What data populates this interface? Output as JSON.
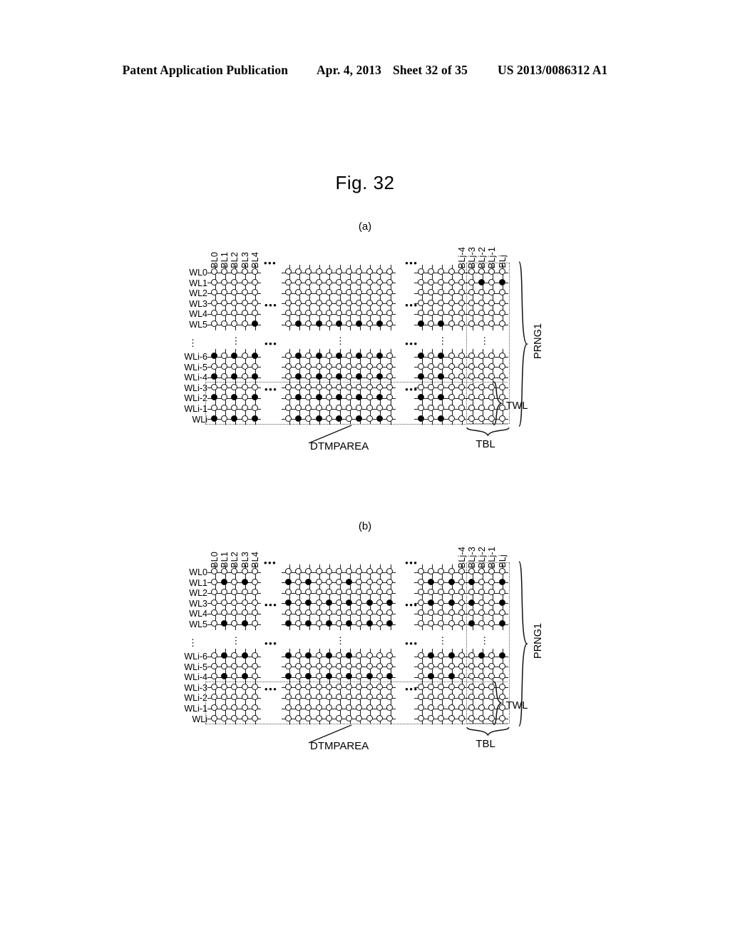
{
  "header": {
    "publication": "Patent Application Publication",
    "date": "Apr. 4, 2013",
    "sheet": "Sheet 32 of 35",
    "number": "US 2013/0086312 A1"
  },
  "figure": {
    "title": "Fig. 32",
    "subfigures": [
      {
        "id": "a",
        "label": "(a)"
      },
      {
        "id": "b",
        "label": "(b)"
      }
    ]
  },
  "axes": {
    "bitline_labels_left": [
      "BL0",
      "BL1",
      "BL2",
      "BL3",
      "BL4"
    ],
    "bitline_labels_right": [
      "BLj-4",
      "BLj-3",
      "BLj-2",
      "BLj-1",
      "BLj"
    ],
    "bitline_ellipsis": "•••",
    "wordline_labels_top": [
      "WL0",
      "WL1",
      "WL2",
      "WL3",
      "WL4",
      "WL5"
    ],
    "wordline_labels_bottom": [
      "WLi-6",
      "WLi-5",
      "WLi-4",
      "WLi-3",
      "WLi-2",
      "WLi-1",
      "WLi"
    ],
    "wordline_ellipsis": "⋮"
  },
  "annotations": {
    "prng1": "PRNG1",
    "twl": "TWL",
    "dtmparea": "DTMPAREA",
    "tbl": "TBL"
  },
  "chart_data": {
    "type": "diagram",
    "description": "Memory cell array maps showing programmed (filled) and erased (open) memory cells across word lines and bit lines",
    "legend": {
      "filled": "programmed cell (solid circle)",
      "open": "erased cell (open circle)"
    },
    "panels": [
      {
        "id": "a",
        "label": "(a)",
        "row_groups": [
          {
            "rows": [
              "WL0",
              "WL1",
              "WL2",
              "WL3",
              "WL4",
              "WL5"
            ]
          },
          {
            "rows": [
              "WLi-6",
              "WLi-5",
              "WLi-4",
              "WLi-3",
              "WLi-2",
              "WLi-1",
              "WLi"
            ]
          }
        ],
        "col_groups": [
          {
            "cols": [
              "BL0",
              "BL1",
              "BL2",
              "BL3",
              "BL4"
            ],
            "count": 5
          },
          {
            "cols": [],
            "count": 11
          },
          {
            "cols": [
              "BLj-4",
              "BLj-3",
              "BLj-2",
              "BLj-1",
              "BLj"
            ],
            "count": 9
          }
        ],
        "blocks": [
          {
            "name": "top-left",
            "cols": 5,
            "rows": 6,
            "filled": [
              [
                5,
                4
              ]
            ]
          },
          {
            "name": "top-mid",
            "cols": 11,
            "rows": 6,
            "filled": [
              [
                5,
                1
              ],
              [
                5,
                3
              ],
              [
                5,
                5
              ],
              [
                5,
                7
              ],
              [
                5,
                9
              ]
            ]
          },
          {
            "name": "top-right",
            "cols": 9,
            "rows": 6,
            "filled": [
              [
                1,
                6
              ],
              [
                1,
                8
              ],
              [
                5,
                0
              ],
              [
                5,
                2
              ]
            ]
          },
          {
            "name": "bottom-left",
            "cols": 5,
            "rows": 7,
            "filled": [
              [
                0,
                0
              ],
              [
                0,
                2
              ],
              [
                0,
                4
              ],
              [
                2,
                0
              ],
              [
                2,
                2
              ],
              [
                2,
                4
              ],
              [
                4,
                0
              ],
              [
                4,
                2
              ],
              [
                4,
                4
              ],
              [
                6,
                0
              ],
              [
                6,
                2
              ],
              [
                6,
                4
              ]
            ]
          },
          {
            "name": "bottom-mid",
            "cols": 11,
            "rows": 7,
            "filled": [
              [
                0,
                1
              ],
              [
                0,
                3
              ],
              [
                0,
                5
              ],
              [
                0,
                7
              ],
              [
                0,
                9
              ],
              [
                2,
                1
              ],
              [
                2,
                3
              ],
              [
                2,
                5
              ],
              [
                2,
                7
              ],
              [
                2,
                9
              ],
              [
                4,
                1
              ],
              [
                4,
                3
              ],
              [
                4,
                5
              ],
              [
                4,
                7
              ],
              [
                4,
                9
              ],
              [
                6,
                1
              ],
              [
                6,
                3
              ],
              [
                6,
                5
              ],
              [
                6,
                7
              ],
              [
                6,
                9
              ]
            ]
          },
          {
            "name": "bottom-right",
            "cols": 9,
            "rows": 7,
            "filled": [
              [
                0,
                0
              ],
              [
                0,
                2
              ],
              [
                2,
                0
              ],
              [
                2,
                2
              ],
              [
                4,
                0
              ],
              [
                4,
                2
              ],
              [
                6,
                0
              ],
              [
                6,
                2
              ]
            ]
          }
        ]
      },
      {
        "id": "b",
        "label": "(b)",
        "row_groups": [
          {
            "rows": [
              "WL0",
              "WL1",
              "WL2",
              "WL3",
              "WL4",
              "WL5"
            ]
          },
          {
            "rows": [
              "WLi-6",
              "WLi-5",
              "WLi-4",
              "WLi-3",
              "WLi-2",
              "WLi-1",
              "WLi"
            ]
          }
        ],
        "col_groups": [
          {
            "cols": [
              "BL0",
              "BL1",
              "BL2",
              "BL3",
              "BL4"
            ],
            "count": 5
          },
          {
            "cols": [],
            "count": 11
          },
          {
            "cols": [
              "BLj-4",
              "BLj-3",
              "BLj-2",
              "BLj-1",
              "BLj"
            ],
            "count": 9
          }
        ],
        "blocks": [
          {
            "name": "top-left",
            "cols": 5,
            "rows": 6,
            "filled": [
              [
                1,
                1
              ],
              [
                1,
                3
              ],
              [
                5,
                1
              ],
              [
                5,
                3
              ]
            ]
          },
          {
            "name": "top-mid",
            "cols": 11,
            "rows": 6,
            "filled": [
              [
                1,
                0
              ],
              [
                1,
                2
              ],
              [
                1,
                6
              ],
              [
                3,
                0
              ],
              [
                3,
                2
              ],
              [
                3,
                4
              ],
              [
                3,
                6
              ],
              [
                3,
                8
              ],
              [
                3,
                10
              ],
              [
                5,
                0
              ],
              [
                5,
                2
              ],
              [
                5,
                4
              ],
              [
                5,
                6
              ],
              [
                5,
                8
              ],
              [
                5,
                10
              ]
            ]
          },
          {
            "name": "top-right",
            "cols": 9,
            "rows": 6,
            "filled": [
              [
                1,
                1
              ],
              [
                1,
                3
              ],
              [
                1,
                5
              ],
              [
                1,
                8
              ],
              [
                3,
                1
              ],
              [
                3,
                3
              ],
              [
                3,
                5
              ],
              [
                3,
                8
              ],
              [
                5,
                5
              ],
              [
                5,
                8
              ]
            ]
          },
          {
            "name": "bottom-left",
            "cols": 5,
            "rows": 7,
            "filled": [
              [
                0,
                1
              ],
              [
                0,
                3
              ],
              [
                2,
                1
              ],
              [
                2,
                3
              ]
            ]
          },
          {
            "name": "bottom-mid",
            "cols": 11,
            "rows": 7,
            "filled": [
              [
                0,
                0
              ],
              [
                0,
                2
              ],
              [
                0,
                4
              ],
              [
                0,
                6
              ],
              [
                2,
                0
              ],
              [
                2,
                2
              ],
              [
                2,
                4
              ],
              [
                2,
                6
              ],
              [
                2,
                8
              ],
              [
                2,
                10
              ]
            ]
          },
          {
            "name": "bottom-right",
            "cols": 9,
            "rows": 7,
            "filled": [
              [
                0,
                1
              ],
              [
                0,
                3
              ],
              [
                0,
                6
              ],
              [
                0,
                8
              ],
              [
                2,
                1
              ],
              [
                2,
                3
              ]
            ]
          }
        ]
      }
    ]
  }
}
